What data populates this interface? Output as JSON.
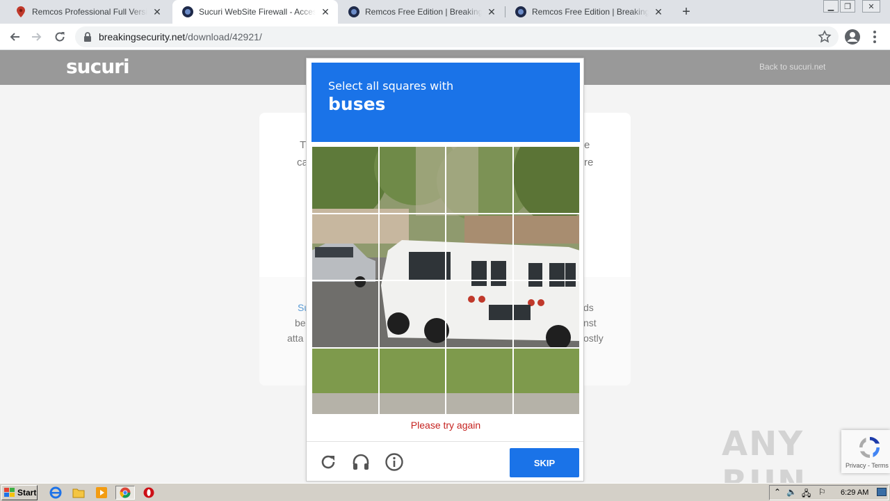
{
  "browser": {
    "tabs": [
      {
        "title": "Remcos Professional Full Version Download",
        "active": false,
        "icon": "map-pin-icon"
      },
      {
        "title": "Sucuri WebSite Firewall - Access Denied",
        "active": true,
        "icon": "breakingsecurity-icon"
      },
      {
        "title": "Remcos Free Edition | BreakingSecurity",
        "active": false,
        "icon": "breakingsecurity-icon"
      },
      {
        "title": "Remcos Free Edition | BreakingSecurity",
        "active": false,
        "icon": "breakingsecurity-icon"
      }
    ],
    "new_tab": "+",
    "url_host": "breakingsecurity.net",
    "url_path": "/download/42921/"
  },
  "page": {
    "logo": "sucuri",
    "back_link": "Back to sucuri.net",
    "fragments": {
      "left1": "T",
      "left2": "ca",
      "right1": "e",
      "right2": "re",
      "left3": "Su",
      "left4": "be",
      "left5": "atta",
      "right3": "ds",
      "right4": "nst",
      "right5": "ostly"
    }
  },
  "captcha": {
    "instruction": "Select all squares with",
    "target": "buses",
    "error": "Please try again",
    "skip_label": "SKIP",
    "grid": {
      "rows": 4,
      "cols": 4
    }
  },
  "badge": {
    "terms": "Privacy - Terms"
  },
  "watermark": "ANY RUN",
  "taskbar": {
    "start_label": "Start",
    "clock": "6:29 AM"
  },
  "colors": {
    "captcha_blue": "#1a73e8",
    "error_red": "#c5221f",
    "header_gray": "#999999"
  }
}
